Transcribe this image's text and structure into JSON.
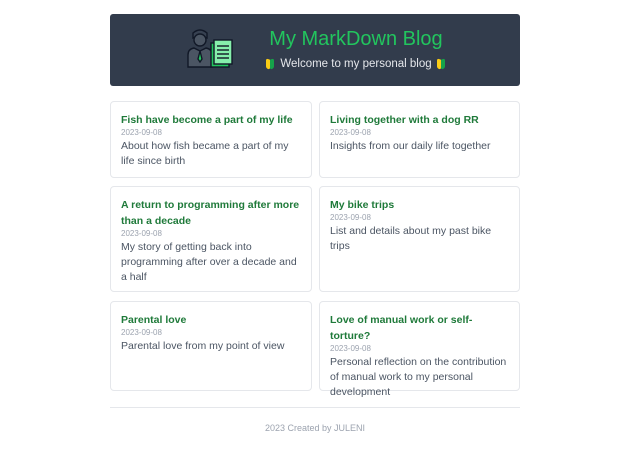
{
  "header": {
    "title": "My MarkDown Blog",
    "subtitle": "Welcome to my personal blog",
    "logo_icon": "blogger-avatar-icon",
    "leaf_icon": "beginner-mark-icon"
  },
  "posts": [
    {
      "title": "Fish have become a part of my life",
      "date": "2023-09-08",
      "description": "About how fish became a part of my life since birth"
    },
    {
      "title": "Living together with a dog RR",
      "date": "2023-09-08",
      "description": "Insights from our daily life together"
    },
    {
      "title": "A return to programming after more than a decade",
      "date": "2023-09-08",
      "description": "My story of getting back into programming after over a decade and a half"
    },
    {
      "title": "My bike trips",
      "date": "2023-09-08",
      "description": "List and details about my past bike trips"
    },
    {
      "title": "Parental love",
      "date": "2023-09-08",
      "description": "Parental love from my point of view"
    },
    {
      "title": "Love of manual work or self-torture?",
      "date": "2023-09-08",
      "description": "Personal reflection on the contribution of manual work to my personal development"
    }
  ],
  "footer": {
    "text": "2023 Created by JULENI"
  },
  "colors": {
    "header_bg": "#323c4c",
    "title_green": "#22c55e",
    "card_title_green": "#1f7a3a"
  }
}
